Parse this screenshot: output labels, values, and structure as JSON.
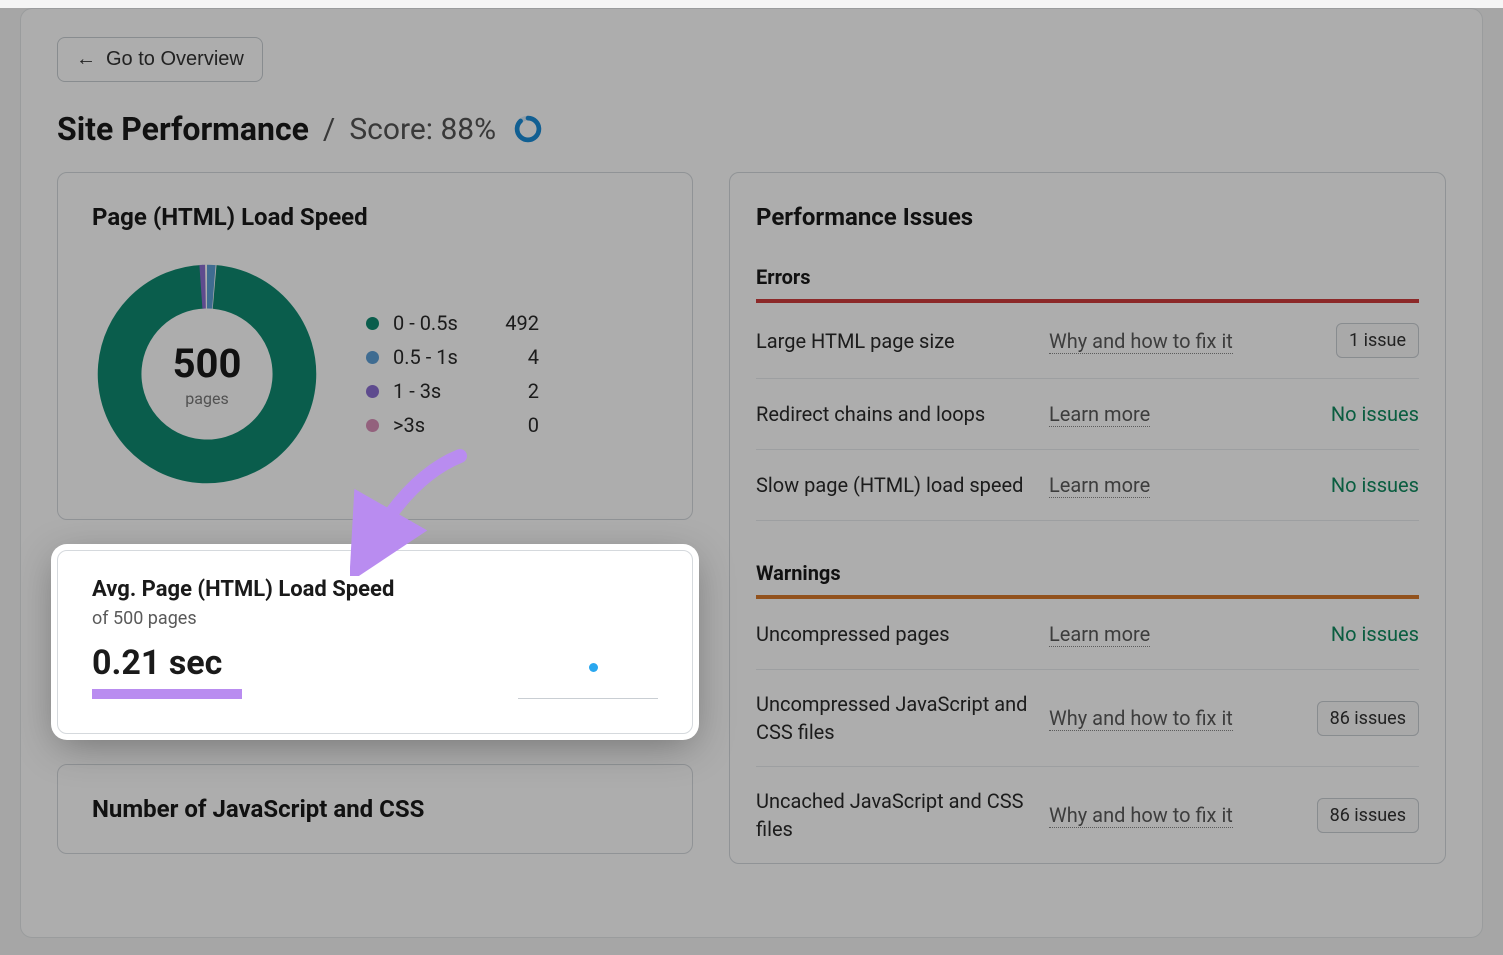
{
  "back_button": "Go to Overview",
  "page_title": "Site Performance",
  "score_separator": "/",
  "score_label": "Score: 88%",
  "score_percent": 88,
  "load_speed": {
    "title": "Page (HTML) Load Speed",
    "total": "500",
    "total_label": "pages",
    "legend": [
      {
        "label": "0 - 0.5s",
        "value": "492",
        "color": "#108a70"
      },
      {
        "label": "0.5 - 1s",
        "value": "4",
        "color": "#5e9fd6"
      },
      {
        "label": "1 - 3s",
        "value": "2",
        "color": "#8b6fd1"
      },
      {
        "label": ">3s",
        "value": "0",
        "color": "#d98fb8"
      }
    ]
  },
  "chart_data": {
    "type": "pie",
    "title": "Page (HTML) Load Speed",
    "categories": [
      "0 - 0.5s",
      "0.5 - 1s",
      "1 - 3s",
      ">3s"
    ],
    "values": [
      492,
      4,
      2,
      0
    ],
    "total": 500,
    "colors": [
      "#108a70",
      "#5e9fd6",
      "#8b6fd1",
      "#d98fb8"
    ]
  },
  "avg_speed": {
    "title": "Avg. Page (HTML) Load Speed",
    "subtitle": "of 500 pages",
    "value": "0.21 sec"
  },
  "jscss": {
    "title": "Number of JavaScript and CSS"
  },
  "issues": {
    "panel_title": "Performance Issues",
    "errors_label": "Errors",
    "warnings_label": "Warnings",
    "errors": [
      {
        "name": "Large HTML page size",
        "link": "Why and how to fix it",
        "status_type": "pill",
        "status": "1 issue"
      },
      {
        "name": "Redirect chains and loops",
        "link": "Learn more",
        "status_type": "text",
        "status": "No issues"
      },
      {
        "name": "Slow page (HTML) load speed",
        "link": "Learn more",
        "status_type": "text",
        "status": "No issues"
      }
    ],
    "warnings": [
      {
        "name": "Uncompressed pages",
        "link": "Learn more",
        "status_type": "text",
        "status": "No issues"
      },
      {
        "name": "Uncompressed JavaScript and CSS files",
        "link": "Why and how to fix it",
        "status_type": "pill",
        "status": "86 issues"
      },
      {
        "name": "Uncached JavaScript and CSS files",
        "link": "Why and how to fix it",
        "status_type": "pill",
        "status": "86 issues"
      }
    ]
  }
}
